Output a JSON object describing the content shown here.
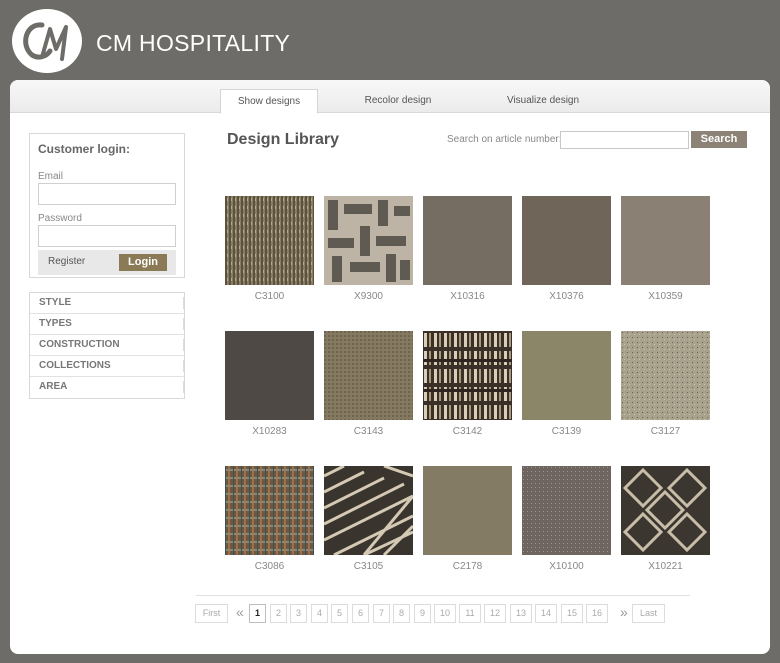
{
  "brand": {
    "name": "CM HOSPITALITY",
    "logo_text": "CM"
  },
  "tabs": [
    {
      "label": "Show designs"
    },
    {
      "label": "Recolor design"
    },
    {
      "label": "Visualize design"
    }
  ],
  "login": {
    "title": "Customer login:",
    "email_label": "Email",
    "password_label": "Password",
    "register_label": "Register",
    "login_label": "Login"
  },
  "filters": [
    {
      "label": "STYLE"
    },
    {
      "label": "TYPES"
    },
    {
      "label": "CONSTRUCTION"
    },
    {
      "label": "COLLECTIONS"
    },
    {
      "label": "AREA"
    }
  ],
  "main": {
    "title": "Design Library",
    "search_label": "Search on article number:",
    "search_button": "Search"
  },
  "designs": [
    {
      "code": "C3100"
    },
    {
      "code": "X9300"
    },
    {
      "code": "X10316"
    },
    {
      "code": "X10376"
    },
    {
      "code": "X10359"
    },
    {
      "code": "X10283"
    },
    {
      "code": "C3143"
    },
    {
      "code": "C3142"
    },
    {
      "code": "C3139"
    },
    {
      "code": "C3127"
    },
    {
      "code": "C3086"
    },
    {
      "code": "C3105"
    },
    {
      "code": "C2178"
    },
    {
      "code": "X10100"
    },
    {
      "code": "X10221"
    }
  ],
  "pagination": {
    "first": "First",
    "prev": "«",
    "pages": [
      "1",
      "2",
      "3",
      "4",
      "5",
      "6",
      "7",
      "8",
      "9",
      "10",
      "11",
      "12",
      "13",
      "14",
      "15",
      "16"
    ],
    "current": "1",
    "next": "»",
    "last": "Last"
  },
  "colors": {
    "accent_gold": "#8a7a55",
    "search_button": "#8c8276",
    "background": "#6e6c68"
  }
}
